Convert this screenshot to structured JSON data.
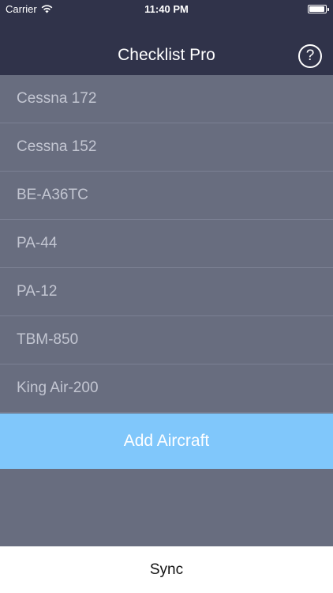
{
  "status_bar": {
    "carrier": "Carrier",
    "time": "11:40 PM",
    "battery_level": 0.95
  },
  "nav": {
    "title": "Checklist Pro",
    "help_label": "?"
  },
  "aircraft": [
    "Cessna 172",
    "Cessna 152",
    "BE-A36TC",
    "PA-44",
    "PA-12",
    "TBM-850",
    "King Air-200"
  ],
  "add_button_label": "Add Aircraft",
  "sync_label": "Sync",
  "colors": {
    "nav_background": "#30334a",
    "list_background": "#686d7f",
    "accent": "#80c7fb"
  }
}
